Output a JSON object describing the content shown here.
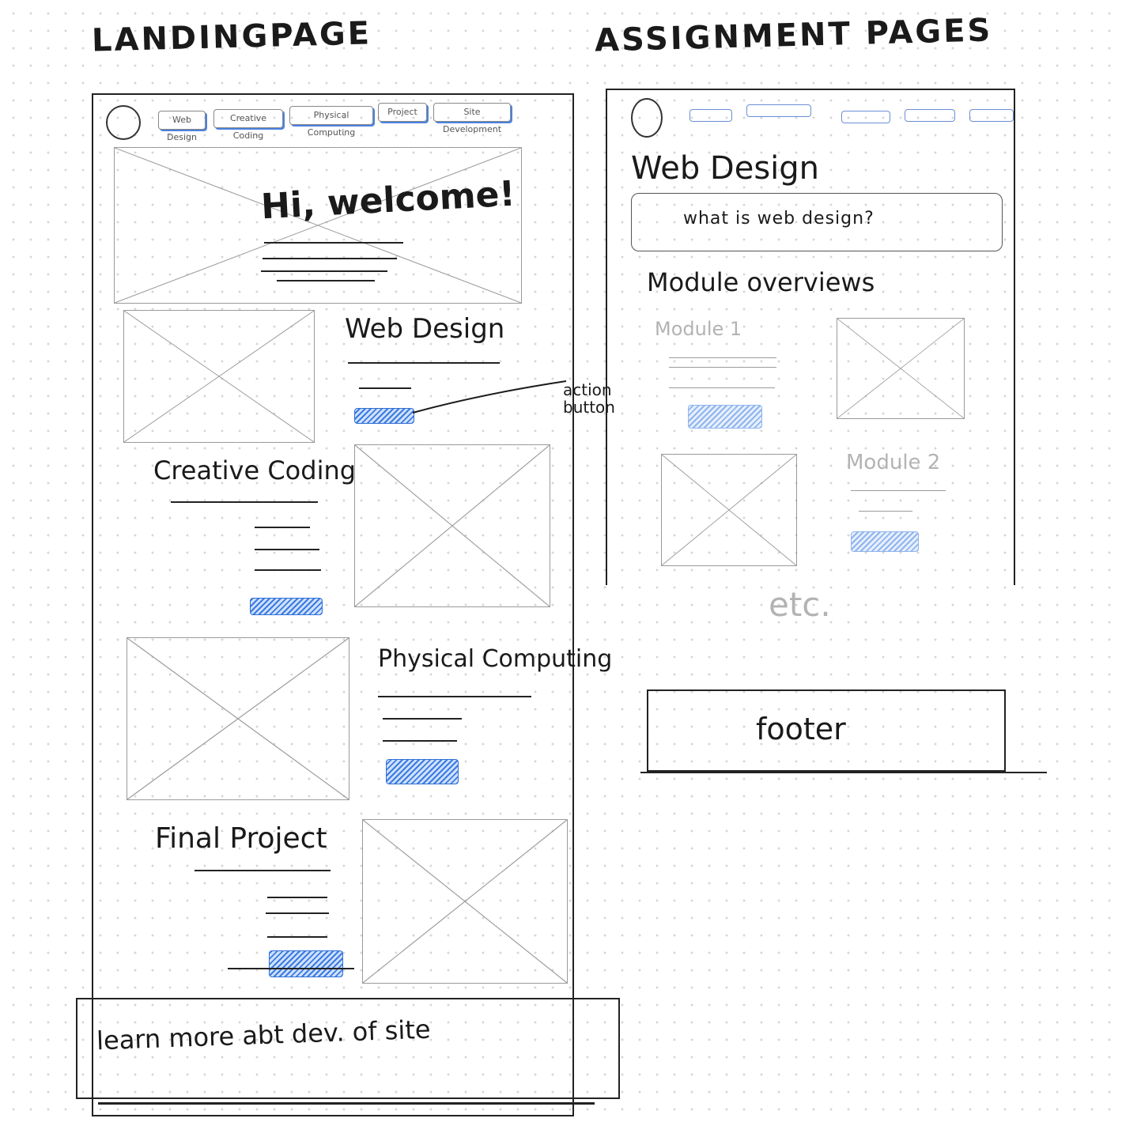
{
  "landing": {
    "title": "LANDINGPAGE",
    "nav": [
      "Web Design",
      "Creative Coding",
      "Physical Computing",
      "Project",
      "Site Development"
    ],
    "hero_text": "Hi, welcome!",
    "sections": [
      {
        "title": "Web Design"
      },
      {
        "title": "Creative Coding"
      },
      {
        "title": "Physical Computing"
      },
      {
        "title": "Final Project"
      }
    ],
    "annotation": "action button",
    "footer_text": "learn more abt dev. of site"
  },
  "assignment": {
    "title": "ASSIGNMENT PAGES",
    "page_title": "Web Design",
    "intro_box": "what is web design?",
    "overview_heading": "Module overviews",
    "modules": [
      {
        "label": "Module 1"
      },
      {
        "label": "Module 2"
      }
    ],
    "etc": "etc.",
    "footer": "footer"
  },
  "colors": {
    "ink": "#1a1a1a",
    "accent": "#3a7be0",
    "placeholder": "#9a9a9a"
  }
}
